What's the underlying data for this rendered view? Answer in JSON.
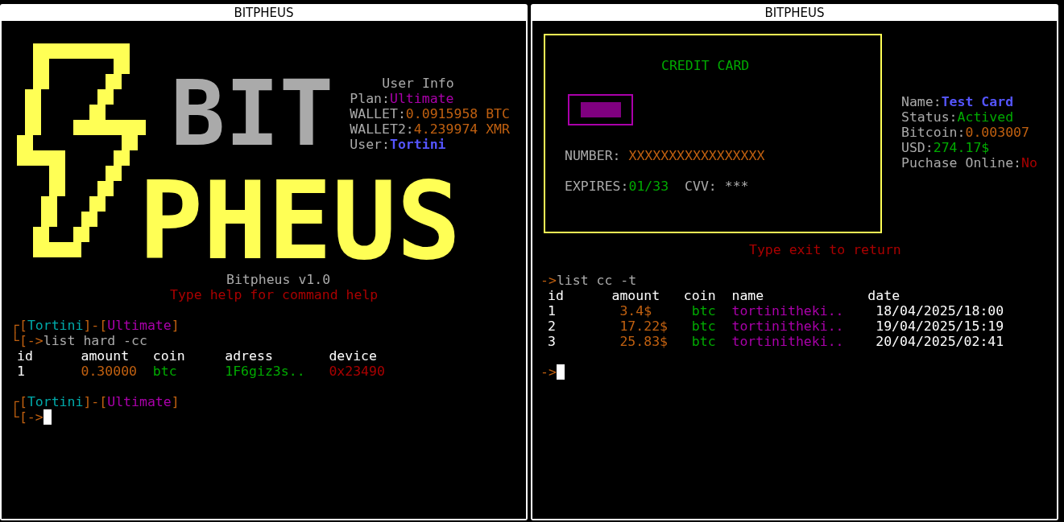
{
  "left_window": {
    "title": "BITPHEUS",
    "logo": {
      "line_1": "BIT",
      "line_2": "PHEUS"
    },
    "user_info": {
      "heading": "User Info",
      "fields": [
        {
          "label": "Plan:",
          "value": "Ultimate",
          "kind": "plan"
        },
        {
          "label": "WALLET:",
          "value": "0.0915958 BTC",
          "kind": "amount"
        },
        {
          "label": "WALLET2:",
          "value": "4.239974 XMR",
          "kind": "amount"
        },
        {
          "label": "User:",
          "value": "Tortini",
          "kind": "user"
        }
      ]
    },
    "version": "Bitpheus v1.0",
    "help_hint": "Type help for command help",
    "sessions": [
      {
        "prompt": {
          "open": "┌[",
          "user": "Tortini",
          "separator": "]-[",
          "plan": "Ultimate",
          "close": "]",
          "arrow": "└[->"
        },
        "command": "list hard -cc",
        "table": {
          "columns": [
            {
              "label": "id",
              "kind": "plain"
            },
            {
              "label": "amount",
              "kind": "amount"
            },
            {
              "label": "coin",
              "kind": "coin"
            },
            {
              "label": "adress",
              "kind": "coin"
            },
            {
              "label": "device",
              "kind": "flag"
            }
          ],
          "rows": [
            [
              "1",
              "0.30000",
              "btc",
              "1F6giz3s..",
              "0x23490"
            ]
          ]
        }
      },
      {
        "prompt": {
          "open": "┌[",
          "user": "Tortini",
          "separator": "]-[",
          "plan": "Ultimate",
          "close": "]",
          "arrow": "└[->"
        },
        "cursor": true
      }
    ]
  },
  "right_window": {
    "title": "BITPHEUS",
    "card": {
      "heading": "CREDIT CARD",
      "number_label": "NUMBER:",
      "number": "XXXXXXXXXXXXXXXXX",
      "expires_label": "EXPIRES:",
      "expires": "01/33",
      "cvv_label": "CVV:",
      "cvv": "***"
    },
    "card_info": [
      {
        "label": "Name:",
        "value": "Test Card",
        "kind": "user"
      },
      {
        "label": "Status:",
        "value": "Actived",
        "kind": "status"
      },
      {
        "label": "Bitcoin:",
        "value": "0.003007",
        "kind": "amount"
      },
      {
        "label": "USD:",
        "value": "274.17$",
        "kind": "status"
      },
      {
        "label": "Puchase Online:",
        "value": "No",
        "kind": "flag"
      }
    ],
    "exit_hint": "Type exit to return",
    "prompt_arrow": "->",
    "command": "list cc -t",
    "table": {
      "columns": [
        {
          "label": "id",
          "kind": "plain"
        },
        {
          "label": "amount",
          "kind": "amount"
        },
        {
          "label": "coin",
          "kind": "coin"
        },
        {
          "label": "name",
          "kind": "plan"
        },
        {
          "label": "date",
          "kind": "plain"
        }
      ],
      "rows": [
        [
          "1",
          "3.4$",
          "btc",
          "tortinitheki..",
          "18/04/2025/18:00"
        ],
        [
          "2",
          "17.22$",
          "btc",
          "tortinitheki..",
          "19/04/2025/15:19"
        ],
        [
          "3",
          "25.83$",
          "btc",
          "tortinitheki..",
          "20/04/2025/02:41"
        ]
      ]
    },
    "final_prompt": "->",
    "cursor": true
  }
}
